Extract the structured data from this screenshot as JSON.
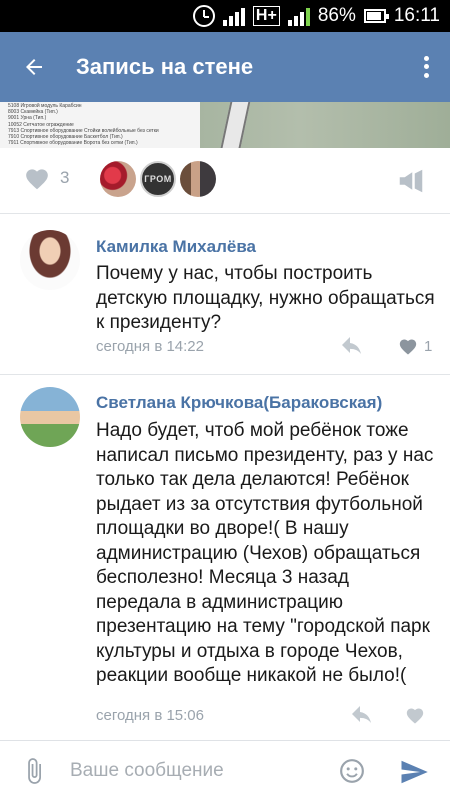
{
  "status_bar": {
    "network_type": "H+",
    "battery_percent": "86%",
    "time": "16:11"
  },
  "header": {
    "title": "Запись на стене"
  },
  "post_image": {
    "list_lines": [
      "5108 Игровой модуль Карабсин",
      "8003 Скамейка (Тип.)",
      "9001 Урна (Тип.)",
      "10052 Сетчатое ограждение",
      "7913 Спортивное оборудование Стойки волейбольные без сетки",
      "7910 Спортивное оборудование Баскетбол (Тип.)",
      "7911 Спортивное оборудование Ворота без сетки (Тип.)"
    ]
  },
  "post_actions": {
    "likes_count": "3",
    "liker_badge_text": "ГРОМ"
  },
  "comments": [
    {
      "author": "Камилка Михалёва",
      "text": "Почему у нас, чтобы построить детскую площадку, нужно обращаться к президенту?",
      "timestamp": "сегодня в 14:22",
      "likes": "1"
    },
    {
      "author": "Светлана Крючкова(Бараковская)",
      "text": "Надо будет, чтоб мой ребёнок тоже написал письмо президенту, раз у нас только так дела делаются! Ребёнок рыдает из за отсутствия футбольной площадки во дворе!( В нашу администрацию (Чехов) обращаться бесполезно! Месяца 3 назад передала в администрацию презентацию на тему \"городской парк культуры и отдыха в городе Чехов, реакции вообще никакой не было!(",
      "timestamp": "сегодня в 15:06",
      "likes": ""
    }
  ],
  "composer": {
    "placeholder": "Ваше сообщение"
  },
  "colors": {
    "accent": "#5b81b2",
    "author_link": "#4a73a5",
    "muted": "#9aa3ac"
  },
  "icons": [
    "alarm-icon",
    "signal-icon",
    "battery-icon",
    "back-arrow-icon",
    "more-vertical-icon",
    "heart-icon",
    "megaphone-icon",
    "reply-icon",
    "paperclip-icon",
    "emoji-icon",
    "send-icon"
  ]
}
